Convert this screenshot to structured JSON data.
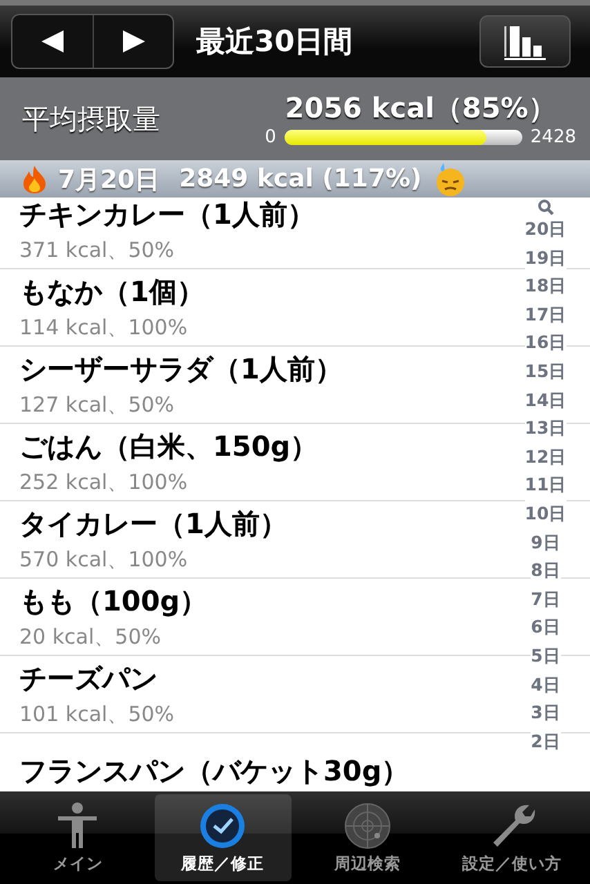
{
  "nav": {
    "title": "最近30日間"
  },
  "summary": {
    "label": "平均摂取量",
    "value": "2056 kcal（85%）",
    "min": "0",
    "max": "2428",
    "level": 0.85
  },
  "section": {
    "date": "7月20日",
    "total": "2849 kcal (117%)"
  },
  "entries": [
    {
      "name": "チキンカレー（1人前）",
      "detail": "371 kcal、50%"
    },
    {
      "name": "もなか（1個）",
      "detail": "114 kcal、100%"
    },
    {
      "name": "シーザーサラダ（1人前）",
      "detail": "127 kcal、50%"
    },
    {
      "name": "ごはん（白米、150g）",
      "detail": "252 kcal、100%"
    },
    {
      "name": "タイカレー（1人前）",
      "detail": "570 kcal、100%"
    },
    {
      "name": "もも（100g）",
      "detail": "20 kcal、50%"
    },
    {
      "name": "チーズパン",
      "detail": "101 kcal、50%"
    },
    {
      "name": "フランスパン（バケット30g）"
    }
  ],
  "index": [
    "20日",
    "19日",
    "18日",
    "17日",
    "16日",
    "15日",
    "14日",
    "13日",
    "12日",
    "11日",
    "10日",
    "9日",
    "8日",
    "7日",
    "6日",
    "5日",
    "4日",
    "3日",
    "2日"
  ],
  "tabs": [
    {
      "label": "メイン",
      "selected": false
    },
    {
      "label": "履歴／修正",
      "selected": true
    },
    {
      "label": "周辺検索",
      "selected": false
    },
    {
      "label": "設定／使い方",
      "selected": false
    }
  ]
}
